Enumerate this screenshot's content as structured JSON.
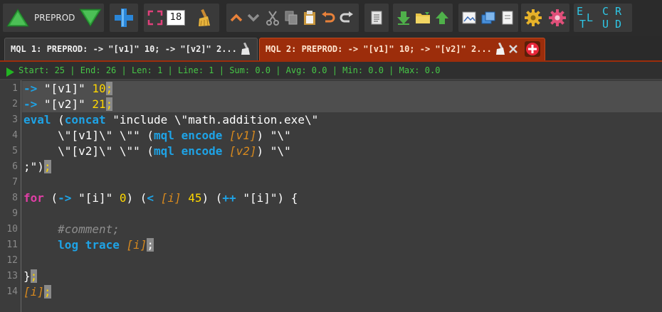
{
  "toolbar": {
    "env_label": "PREPROD",
    "font_size": "18",
    "crud": {
      "e": "E",
      "l": "L",
      "t": "T",
      "c": "C",
      "r": "R",
      "u": "U",
      "d": "D"
    },
    "icons": [
      "triangle-up-icon",
      "triangle-down-icon",
      "plus-icon",
      "fullscreen-icon",
      "broom-icon",
      "chevron-up-icon",
      "chevron-down-icon",
      "scissors-icon",
      "copy-icon",
      "paste-icon",
      "undo-icon",
      "redo-icon",
      "document-icon",
      "download-arrow-icon",
      "folder-icon",
      "upload-arrow-icon",
      "image-icon",
      "windows-icon",
      "page-icon",
      "gear-icon",
      "gear-pink-icon"
    ]
  },
  "tabs": [
    {
      "label": "MQL 1: PREPROD: -> \"[v1]\" 10; -> \"[v2]\" 2...",
      "active": false
    },
    {
      "label": "MQL 2: PREPROD: -> \"[v1]\" 10; -> \"[v2]\" 2...",
      "active": true
    }
  ],
  "status": {
    "text": "Start: 25 | End: 26 | Len: 1 | Line: 1 | Sum: 0.0 | Avg: 0.0 | Min: 0.0 | Max: 0.0"
  },
  "editor": {
    "line_numbers": [
      "1",
      "2",
      "3",
      "4",
      "5",
      "6",
      "7",
      "8",
      "9",
      "10",
      "11",
      "12",
      "13",
      "14"
    ],
    "lines": [
      [
        {
          "t": "-> ",
          "c": "kw-cyan"
        },
        {
          "t": "\"[v1]\" ",
          "c": ""
        },
        {
          "t": "10",
          "c": "num"
        },
        {
          "t": ";",
          "c": "hl"
        }
      ],
      [
        {
          "t": "-> ",
          "c": "kw-cyan"
        },
        {
          "t": "\"[v2]\" ",
          "c": ""
        },
        {
          "t": "21",
          "c": "num"
        },
        {
          "t": ";",
          "c": "hl"
        }
      ],
      [
        {
          "t": "eval",
          "c": "kw-cyan"
        },
        {
          "t": " (",
          "c": ""
        },
        {
          "t": "concat",
          "c": "kw-cyan"
        },
        {
          "t": " \"include \\\"math.addition.exe\\\"",
          "c": ""
        }
      ],
      [
        {
          "t": "     \\\"[v1]\\\" \\\"\" (",
          "c": ""
        },
        {
          "t": "mql encode",
          "c": "kw-cyan"
        },
        {
          "t": " ",
          "c": ""
        },
        {
          "t": "[v1]",
          "c": "var"
        },
        {
          "t": ") \"\\\"",
          "c": ""
        }
      ],
      [
        {
          "t": "     \\\"[v2]\\\" \\\"\" (",
          "c": ""
        },
        {
          "t": "mql encode",
          "c": "kw-cyan"
        },
        {
          "t": " ",
          "c": ""
        },
        {
          "t": "[v2]",
          "c": "var"
        },
        {
          "t": ") \"\\\"",
          "c": ""
        }
      ],
      [
        {
          "t": ";\")",
          "c": ""
        },
        {
          "t": ";",
          "c": "hl"
        }
      ],
      [],
      [
        {
          "t": "for",
          "c": "kw-pink"
        },
        {
          "t": " (",
          "c": ""
        },
        {
          "t": "->",
          "c": "kw-cyan"
        },
        {
          "t": " \"[i]\" ",
          "c": ""
        },
        {
          "t": "0",
          "c": "num"
        },
        {
          "t": ") (",
          "c": ""
        },
        {
          "t": "<",
          "c": "kw-cyan"
        },
        {
          "t": " ",
          "c": ""
        },
        {
          "t": "[i]",
          "c": "var"
        },
        {
          "t": " ",
          "c": ""
        },
        {
          "t": "45",
          "c": "num"
        },
        {
          "t": ") (",
          "c": ""
        },
        {
          "t": "++",
          "c": "kw-cyan"
        },
        {
          "t": " \"[i]\") {",
          "c": ""
        }
      ],
      [],
      [
        {
          "t": "     #comment;",
          "c": "cmt"
        }
      ],
      [
        {
          "t": "     ",
          "c": ""
        },
        {
          "t": "log trace",
          "c": "kw-cyan"
        },
        {
          "t": " ",
          "c": ""
        },
        {
          "t": "[i]",
          "c": "var"
        },
        {
          "t": ";",
          "c": "hl-plain"
        }
      ],
      [],
      [
        {
          "t": "}",
          "c": ""
        },
        {
          "t": ";",
          "c": "hl"
        }
      ],
      [
        {
          "t": "[i]",
          "c": "var"
        },
        {
          "t": ";",
          "c": "hl"
        }
      ]
    ]
  },
  "colors": {
    "accent_tab": "#9c2d0b",
    "status_green": "#46c746",
    "keyword_cyan": "#1ea3e6",
    "keyword_pink": "#e13ea6",
    "variable_orange": "#d98a1e",
    "number_yellow": "#ffd700"
  }
}
